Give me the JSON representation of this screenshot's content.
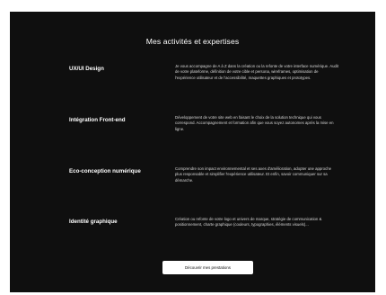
{
  "section": {
    "title": "Mes activités et expertises"
  },
  "items": [
    {
      "title": "UX/UI Design",
      "description": "Je vous accompagne de A à Z dans la création ou la refonte de votre interface numérique. Audit de votre plateforme, définition de votre cible et persona, wireframes, optimisation de l'expérience utilisateur et de l'accessibilité, maquettes graphiques et prototypes."
    },
    {
      "title": "Intégration Front-end",
      "description": "Développement de votre site web en faisant le choix de la solution technique qui vous correspond. Accompagnement et formation afin que vous soyez autonomes après la mise en ligne."
    },
    {
      "title": "Eco-conception numérique",
      "description": "Comprendre son impact environnemental et ses axes d'amélioration, adopter une approche plus responsable et simplifier l'expérience utilisateur. Et enfin, savoir communiquer sur sa démarche."
    },
    {
      "title": "Identité graphique",
      "description": "Création ou refonte de votre logo et univers de marque, stratégie de communication & positionnement, charte graphique (couleurs, typographies, éléments visuels)..."
    }
  ],
  "cta": {
    "label": "Découvrir mes prestations"
  }
}
